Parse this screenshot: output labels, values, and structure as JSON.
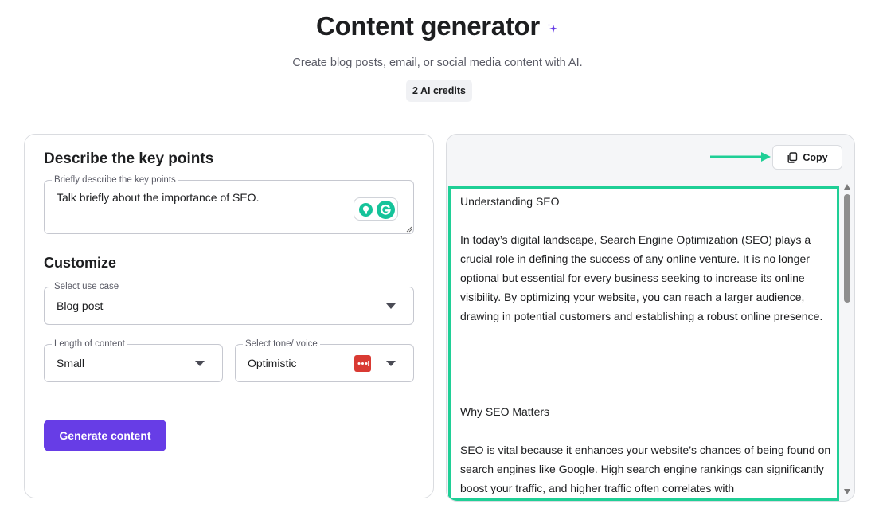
{
  "header": {
    "title": "Content generator",
    "subtitle": "Create blog posts, email, or social media content with AI.",
    "credits": "2 AI credits"
  },
  "key_points": {
    "section_title": "Describe the key points",
    "label": "Briefly describe the key points",
    "value": "Talk briefly about the importance of SEO."
  },
  "customize": {
    "section_title": "Customize",
    "use_case": {
      "label": "Select use case",
      "value": "Blog post"
    },
    "length": {
      "label": "Length of content",
      "value": "Small"
    },
    "tone": {
      "label": "Select tone/ voice",
      "value": "Optimistic"
    }
  },
  "generate_button": "Generate content",
  "output": {
    "copy_label": "Copy",
    "paragraphs": [
      "Understanding SEO",
      "In today’s digital landscape, Search Engine Optimization (SEO) plays a crucial role in defining the success of any online venture. It is no longer optional but essential for every business seeking to increase its online visibility. By optimizing your website, you can reach a larger audience, drawing in potential customers and establishing a robust online presence.",
      "Why SEO Matters",
      "SEO is vital because it enhances your website’s chances of being found on search engines like Google. High search engine rankings can significantly boost your traffic, and higher traffic often correlates with"
    ]
  },
  "colors": {
    "accent": "#673de6",
    "highlight": "#1fcf96",
    "grammarly": "#15c39a",
    "password_icon": "#d93a33"
  }
}
